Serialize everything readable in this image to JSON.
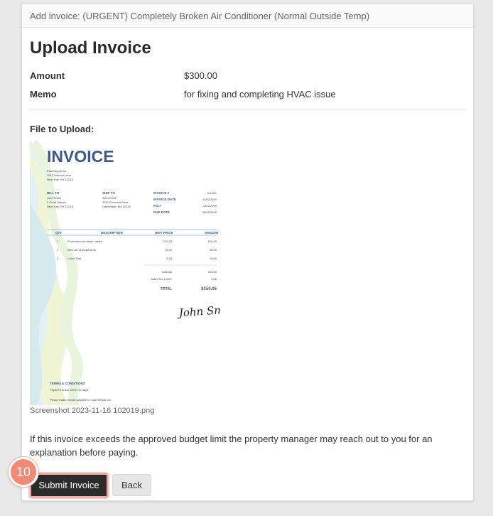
{
  "header": {
    "title": "Add invoice: (URGENT) Completely Broken Air Conditioner (Normal Outside Temp)"
  },
  "page_title": "Upload Invoice",
  "fields": {
    "amount_label": "Amount",
    "amount_value": "$300.00",
    "memo_label": "Memo",
    "memo_value": "for fixing and completing HVAC issue"
  },
  "file": {
    "label": "File to Upload:",
    "filename": "Screenshot 2023-11-16 102019.png"
  },
  "notice": "If this invoice exceeds the approved budget limit the property manager may reach out to you for an explanation before paying.",
  "buttons": {
    "submit": "Submit Invoice",
    "back": "Back"
  },
  "step_badge": "10",
  "colors": {
    "submit_bg": "#2b2b2b",
    "badge": "#f08a75",
    "invoice_blue": "#3a5a8c"
  },
  "invoice_image": {
    "title": "INVOICE",
    "company": [
      "East Repair Inc.",
      "1912 Harvest Lane",
      "New York, NY 12210"
    ],
    "bill_to_label": "BILL TO",
    "bill_to": [
      "John Smith",
      "2 Court Square",
      "New York, NY 12210"
    ],
    "ship_to_label": "SHIP TO",
    "ship_to": [
      "John Smith",
      "3787 Pineview Drive",
      "Cambridge, MA 12210"
    ],
    "meta_labels": [
      "INVOICE #",
      "INVOICE DATE",
      "P.O.#",
      "DUE DATE"
    ],
    "meta_values": [
      "US-001",
      "11/02/2019",
      "2312/2019",
      "26/02/2019"
    ],
    "columns": [
      "QTY",
      "DESCRIPTION",
      "UNIT PRICE",
      "AMOUNT"
    ],
    "rows": [
      [
        "1",
        "Front and rear brake cables",
        "100.00",
        "100.00"
      ],
      [
        "2",
        "New set of pedal arms",
        "15.00",
        "30.00"
      ],
      [
        "3",
        "Labor 3hrs",
        "5.00",
        "15.00"
      ]
    ],
    "subtotal_label": "Subtotal",
    "subtotal": "145.00",
    "tax_label": "Sales Tax 6.25%",
    "tax": "9.06",
    "total_label": "TOTAL",
    "total": "$154.06",
    "signature": "John Smith",
    "terms_label": "TERMS & CONDITIONS",
    "terms": [
      "Payment is due within 15 days",
      "Please make checks payable to: East Repair Inc."
    ]
  }
}
